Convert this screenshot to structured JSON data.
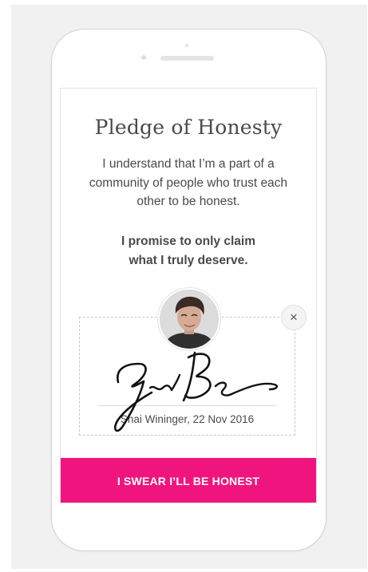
{
  "pledge": {
    "title": "Pledge of Honesty",
    "intro_lines": [
      "I understand that I’m a part of a",
      "community of people who trust each",
      "other to be honest."
    ],
    "promise_lines": [
      "I promise to only claim",
      "what I truly deserve."
    ]
  },
  "signature": {
    "caption": "Shai Wininger, 22 Nov 2016",
    "close_label": "×",
    "icon": "close-icon"
  },
  "avatar": {
    "icon": "user-photo"
  },
  "action": {
    "swear_label": "I SWEAR I’LL BE HONEST"
  },
  "colors": {
    "accent": "#f0157e",
    "text": "#4a4a4a",
    "background": "#f1f1f1"
  }
}
